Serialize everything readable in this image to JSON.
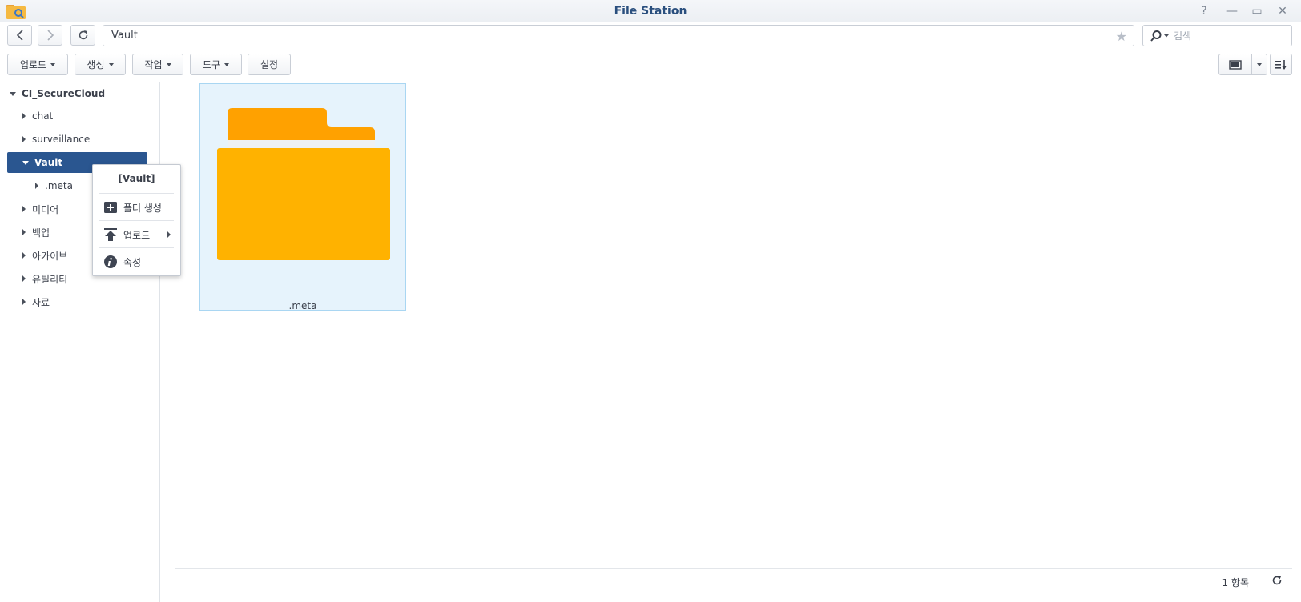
{
  "window": {
    "title": "File Station",
    "help_glyph": "?",
    "minimize_glyph": "—",
    "maximize_glyph": "▭",
    "close_glyph": "✕"
  },
  "nav": {
    "path": "Vault",
    "search_placeholder": "검색"
  },
  "toolbar": {
    "upload": "업로드",
    "create": "생성",
    "action": "작업",
    "tools": "도구",
    "settings": "설정"
  },
  "tree": {
    "root": "CI_SecureCloud",
    "items": [
      {
        "label": "chat"
      },
      {
        "label": "surveillance"
      },
      {
        "label": "Vault"
      },
      {
        "label": ".meta"
      },
      {
        "label": "미디어"
      },
      {
        "label": "백업"
      },
      {
        "label": "아카이브"
      },
      {
        "label": "유틸리티"
      },
      {
        "label": "자료"
      }
    ]
  },
  "context_menu": {
    "title": "[Vault]",
    "items": [
      {
        "label": "폴더 생성",
        "icon": "folder-plus-icon"
      },
      {
        "label": "업로드",
        "icon": "upload-icon"
      },
      {
        "label": "속성",
        "icon": "info-icon"
      }
    ]
  },
  "files": [
    {
      "name": ".meta",
      "type": "folder"
    }
  ],
  "status": {
    "count": "1 항목"
  },
  "colors": {
    "accent": "#2a5690",
    "folder_back": "#ffa100",
    "folder_front": "#ffb200",
    "selection": "#e6f3fc"
  }
}
